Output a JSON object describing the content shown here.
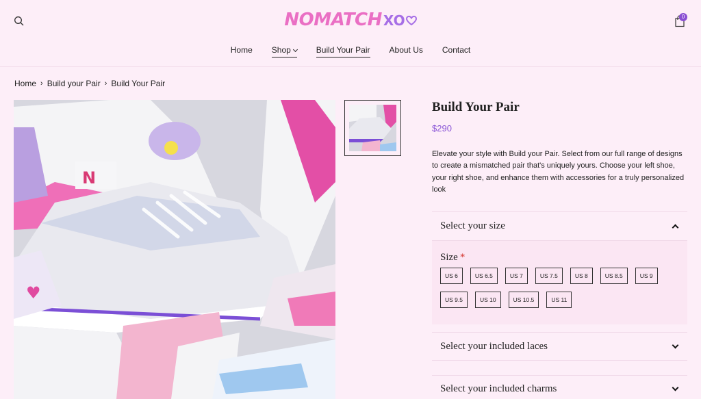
{
  "header": {
    "logo_text": "NOMATCH",
    "logo_suffix": "XO",
    "cart_count": "0",
    "icons": {
      "search": "search-icon",
      "cart": "shopping-bag-icon",
      "logo_heart": "heart-icon"
    }
  },
  "nav": {
    "items": [
      {
        "label": "Home"
      },
      {
        "label": "Shop"
      },
      {
        "label": "Build Your Pair"
      },
      {
        "label": "About Us"
      },
      {
        "label": "Contact"
      }
    ]
  },
  "breadcrumb": {
    "items": [
      {
        "label": "Home"
      },
      {
        "label": "Build your Pair"
      },
      {
        "label": "Build Your Pair"
      }
    ]
  },
  "product": {
    "title": "Build Your Pair",
    "price": "$290",
    "description": "Elevate your style with Build your Pair. Select from our full range of designs to create a mismatched pair that's uniquely yours. Choose your left shoe, your right shoe, and enhance them with accessories for a truly personalized look"
  },
  "accordions": {
    "size": {
      "title": "Select your size",
      "expanded": true
    },
    "laces": {
      "title": "Select your included laces",
      "expanded": false
    },
    "charms": {
      "title": "Select your included charms",
      "expanded": false
    }
  },
  "size_selector": {
    "label": "Size",
    "required_marker": "*",
    "options": [
      "US 6",
      "US 6.5",
      "US 7",
      "US 7.5",
      "US 8",
      "US 8.5",
      "US 9",
      "US 9.5",
      "US 10",
      "US 10.5",
      "US 11"
    ]
  },
  "colors": {
    "background": "#fdeef8",
    "brand_pink": "#ea6fc4",
    "accent_purple": "#8a56d6"
  }
}
